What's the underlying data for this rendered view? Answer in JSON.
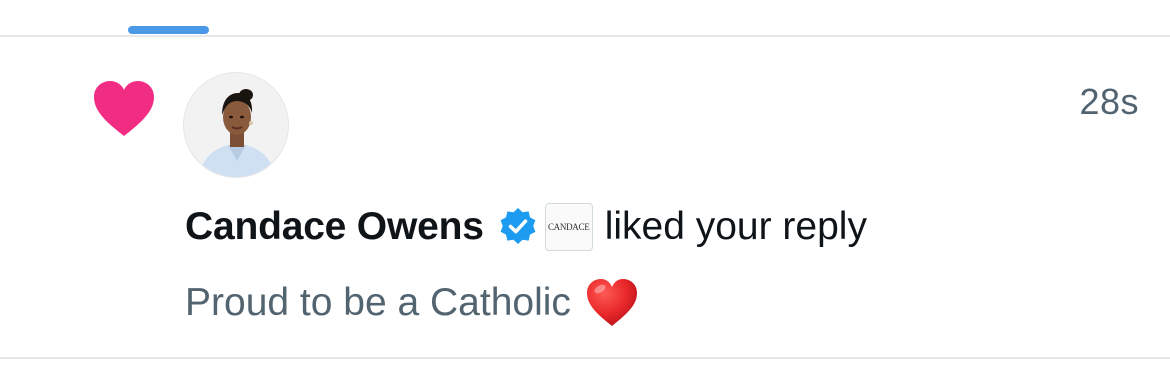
{
  "notification": {
    "type_icon": "heart-icon",
    "timestamp": "28s",
    "user": {
      "name": "Candace Owens",
      "verified_icon": "verified-badge-icon",
      "affiliate_badge_text": "CANDACE",
      "avatar_icon": "profile-avatar"
    },
    "action": "liked your reply",
    "reply": {
      "text": "Proud to be a Catholic",
      "emoji_icon": "red-heart-icon"
    }
  },
  "colors": {
    "like_pink": "#f02c83",
    "accent_blue": "#4a99e9",
    "verified_blue": "#1d9bf0",
    "text_primary": "#0f1419",
    "text_secondary": "#536471",
    "divider": "#e6e9ec"
  }
}
